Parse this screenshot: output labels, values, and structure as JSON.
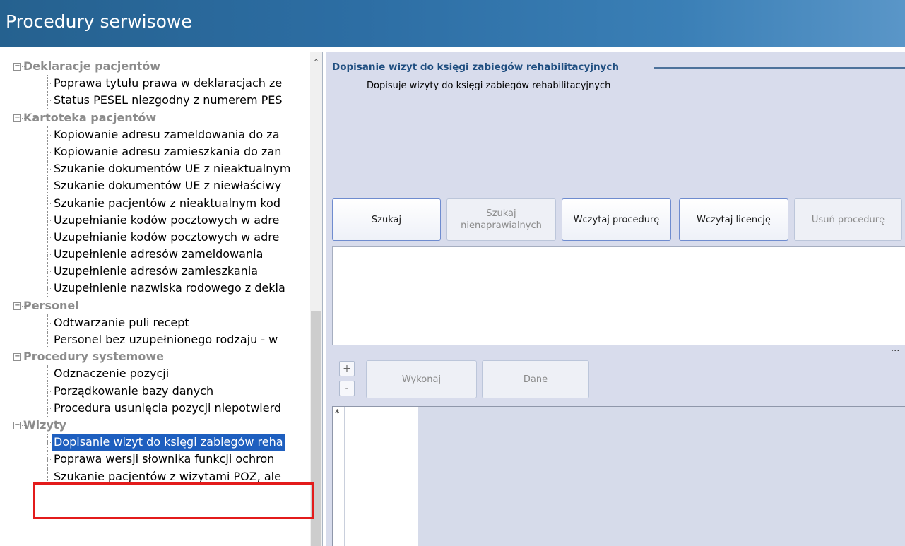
{
  "window": {
    "title": "Procedury serwisowe"
  },
  "tree": {
    "categories": [
      {
        "label": "Deklaracje pacjentów",
        "items": [
          "Poprawa tytułu prawa w deklaracjach ze",
          "Status PESEL niezgodny z numerem PES"
        ]
      },
      {
        "label": "Kartoteka pacjentów",
        "items": [
          "Kopiowanie adresu zameldowania do za",
          "Kopiowanie adresu zamieszkania do zan",
          "Szukanie dokumentów UE z nieaktualnym",
          "Szukanie dokumentów UE z niewłaściwy",
          "Szukanie pacjentów z nieaktualnym kod",
          "Uzupełnianie kodów pocztowych w adre",
          "Uzupełnianie kodów pocztowych w adre",
          "Uzupełnienie adresów zameldowania",
          "Uzupełnienie adresów zamieszkania",
          "Uzupełnienie nazwiska rodowego z dekla"
        ]
      },
      {
        "label": "Personel",
        "items": [
          "Odtwarzanie puli recept",
          "Personel bez uzupełnionego rodzaju - w"
        ]
      },
      {
        "label": "Procedury systemowe",
        "items": [
          "Odznaczenie pozycji",
          "Porządkowanie bazy danych",
          "Procedura usunięcia pozycji niepotwierd"
        ]
      },
      {
        "label": "Wizyty",
        "items": [
          "Dopisanie wizyt do księgi zabiegów reha",
          "Poprawa wersji słownika funkcji ochron",
          "Szukanie pacjentów z wizytami POZ, ale"
        ]
      }
    ],
    "expander_symbol": "−",
    "selected_item": "Dopisanie wizyt do księgi zabiegów reha"
  },
  "details": {
    "title": "Dopisanie wizyt do księgi zabiegów rehabilitacyjnych",
    "description": "Dopisuje wizyty do księgi zabiegów rehabilitacyjnych"
  },
  "toolbar": {
    "search": "Szukaj",
    "search_unfixable_line1": "Szukaj",
    "search_unfixable_line2": "nienaprawialnych",
    "load_procedure": "Wczytaj procedurę",
    "load_license": "Wczytaj licencję",
    "remove_procedure": "Usuń procedurę"
  },
  "params": {
    "plus": "+",
    "minus": "-",
    "execute": "Wykonaj",
    "data": "Dane",
    "splitter_dots": "...",
    "new_row_marker": "*"
  },
  "colors": {
    "accent": "#1f4e80",
    "selection": "#1e5fbf",
    "highlight": "#e31b1b",
    "title_bar": "#2d6ea4"
  }
}
